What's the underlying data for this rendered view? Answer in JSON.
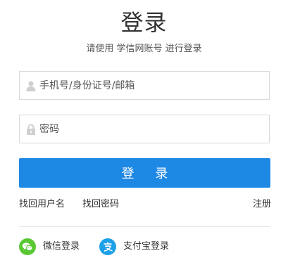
{
  "header": {
    "title": "登录",
    "subtitle": "请使用 学信网账号 进行登录"
  },
  "form": {
    "username": {
      "placeholder": "手机号/身份证号/邮箱",
      "value": "",
      "icon": "user-icon"
    },
    "password": {
      "placeholder": "密码",
      "value": "",
      "icon": "lock-icon"
    },
    "login_label": "登 录"
  },
  "links": {
    "retrieve_username": "找回用户名",
    "retrieve_password": "找回密码",
    "register": "注册"
  },
  "social": {
    "wechat": {
      "label": "微信登录",
      "icon": "wechat-icon",
      "color": "#5ac833"
    },
    "alipay": {
      "label": "支付宝登录",
      "icon": "alipay-icon",
      "color": "#1ca0e8"
    }
  },
  "colors": {
    "primary": "#1e88e5",
    "border": "#d9d9d9",
    "text": "#333333"
  }
}
